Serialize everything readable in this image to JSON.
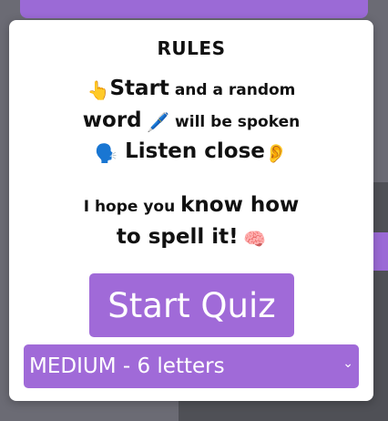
{
  "modal": {
    "title": "RULES",
    "line1": {
      "emoji": "👆",
      "bold": "Start",
      "rest": " and a random"
    },
    "line2": {
      "word": "word",
      "emoji": "🖊️",
      "rest": " will be spoken"
    },
    "line3": {
      "emoji1": "🗣️",
      "text": " Listen close",
      "emoji2": "👂"
    },
    "line4": {
      "small": "I hope you ",
      "big": "know how"
    },
    "line5": {
      "big": "to spell it!",
      "emoji": "🧠"
    },
    "start_button_label": "Start Quiz",
    "difficulty": {
      "selected": "MEDIUM - 6 letters",
      "arrow_icon": "chevron-down-icon"
    }
  },
  "colors": {
    "accent": "#a06ad8",
    "modal_bg": "#ffffff",
    "backdrop": "#6b6b74"
  }
}
